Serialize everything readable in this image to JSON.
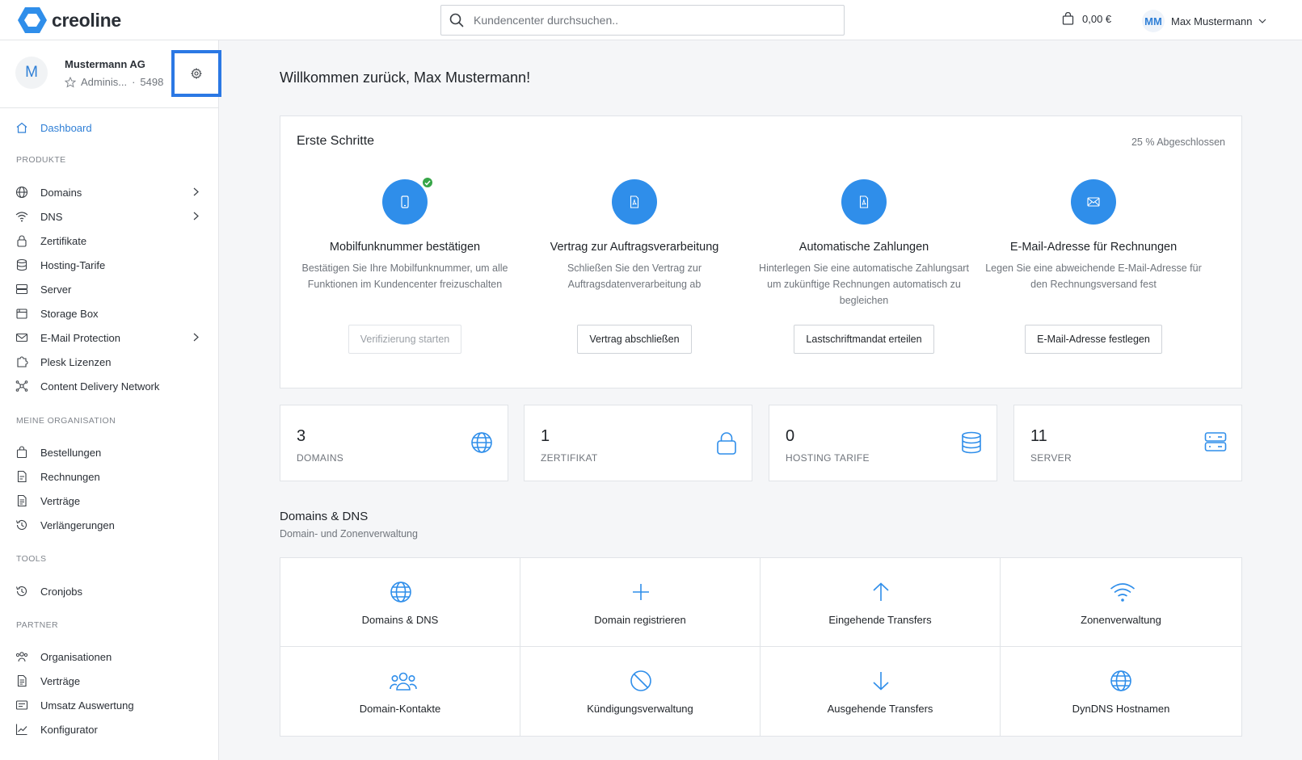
{
  "app": {
    "brand": "creoline",
    "accent": "#2f8eea"
  },
  "header": {
    "search_placeholder": "Kundencenter durchsuchen..",
    "cart_total": "0,00 €",
    "user_initials": "MM",
    "user_name": "Max Mustermann"
  },
  "sidebar": {
    "org_avatar": "M",
    "org_name": "Mustermann AG",
    "org_role": "Adminis...",
    "org_sep": "·",
    "org_number": "5498",
    "dashboard": "Dashboard",
    "sections": {
      "produkte": "PRODUKTE",
      "organisation": "MEINE ORGANISATION",
      "tools": "TOOLS",
      "partner": "PARTNER"
    },
    "produkte": [
      {
        "label": "Domains",
        "icon": "globe-icon"
      },
      {
        "label": "DNS",
        "icon": "wifi-icon"
      },
      {
        "label": "Zertifikate",
        "icon": "lock-icon"
      },
      {
        "label": "Hosting-Tarife",
        "icon": "database-icon"
      },
      {
        "label": "Server",
        "icon": "server-icon"
      },
      {
        "label": "Storage Box",
        "icon": "storage-box-icon"
      },
      {
        "label": "E-Mail Protection",
        "icon": "mail-icon"
      },
      {
        "label": "Plesk Lizenzen",
        "icon": "puzzle-icon"
      },
      {
        "label": "Content Delivery Network",
        "icon": "network-icon"
      }
    ],
    "organisation": [
      {
        "label": "Bestellungen",
        "icon": "bag-icon"
      },
      {
        "label": "Rechnungen",
        "icon": "invoice-icon"
      },
      {
        "label": "Verträge",
        "icon": "contract-icon"
      },
      {
        "label": "Verlängerungen",
        "icon": "history-icon"
      }
    ],
    "tools": [
      {
        "label": "Cronjobs",
        "icon": "history-icon"
      }
    ],
    "partner": [
      {
        "label": "Organisationen",
        "icon": "users-icon"
      },
      {
        "label": "Verträge",
        "icon": "contract-icon"
      },
      {
        "label": "Umsatz Auswertung",
        "icon": "report-icon"
      },
      {
        "label": "Konfigurator",
        "icon": "chart-line-icon"
      }
    ]
  },
  "main": {
    "welcome": "Willkommen zurück, Max Mustermann!",
    "steps": {
      "title": "Erste Schritte",
      "progress": "25 % Abgeschlossen",
      "items": [
        {
          "title": "Mobilfunknummer bestätigen",
          "desc": "Bestätigen Sie Ihre Mobilfunknummer, um alle Funktionen im Kundencenter freizuschalten",
          "button": "Verifizierung starten",
          "done": true
        },
        {
          "title": "Vertrag zur Auftragsverarbeitung",
          "desc": "Schließen Sie den Vertrag zur Auftragsdatenverarbeitung ab",
          "button": "Vertrag abschließen",
          "done": false
        },
        {
          "title": "Automatische Zahlungen",
          "desc": "Hinterlegen Sie eine automatische Zahlungsart um zukünftige Rechnungen automatisch zu begleichen",
          "button": "Lastschriftmandat erteilen",
          "done": false
        },
        {
          "title": "E-Mail-Adresse für Rechnungen",
          "desc": "Legen Sie eine abweichende E-Mail-Adresse für den Rechnungsversand fest",
          "button": "E-Mail-Adresse festlegen",
          "done": false
        }
      ]
    },
    "stats": [
      {
        "value": "3",
        "label": "DOMAINS",
        "icon": "globe-icon"
      },
      {
        "value": "1",
        "label": "ZERTIFIKAT",
        "icon": "lock-icon"
      },
      {
        "value": "0",
        "label": "HOSTING TARIFE",
        "icon": "database-icon"
      },
      {
        "value": "11",
        "label": "SERVER",
        "icon": "server-icon"
      }
    ],
    "domains_section": {
      "title": "Domains & DNS",
      "subtitle": "Domain- und Zonenverwaltung",
      "tiles": [
        {
          "label": "Domains & DNS",
          "icon": "globe-icon"
        },
        {
          "label": "Domain registrieren",
          "icon": "plus-icon"
        },
        {
          "label": "Eingehende Transfers",
          "icon": "arrow-up-icon"
        },
        {
          "label": "Zonenverwaltung",
          "icon": "wifi-icon"
        },
        {
          "label": "Domain-Kontakte",
          "icon": "users-icon"
        },
        {
          "label": "Kündigungsverwaltung",
          "icon": "ban-icon"
        },
        {
          "label": "Ausgehende Transfers",
          "icon": "arrow-down-icon"
        },
        {
          "label": "DynDNS Hostnamen",
          "icon": "globe-icon"
        }
      ]
    }
  }
}
